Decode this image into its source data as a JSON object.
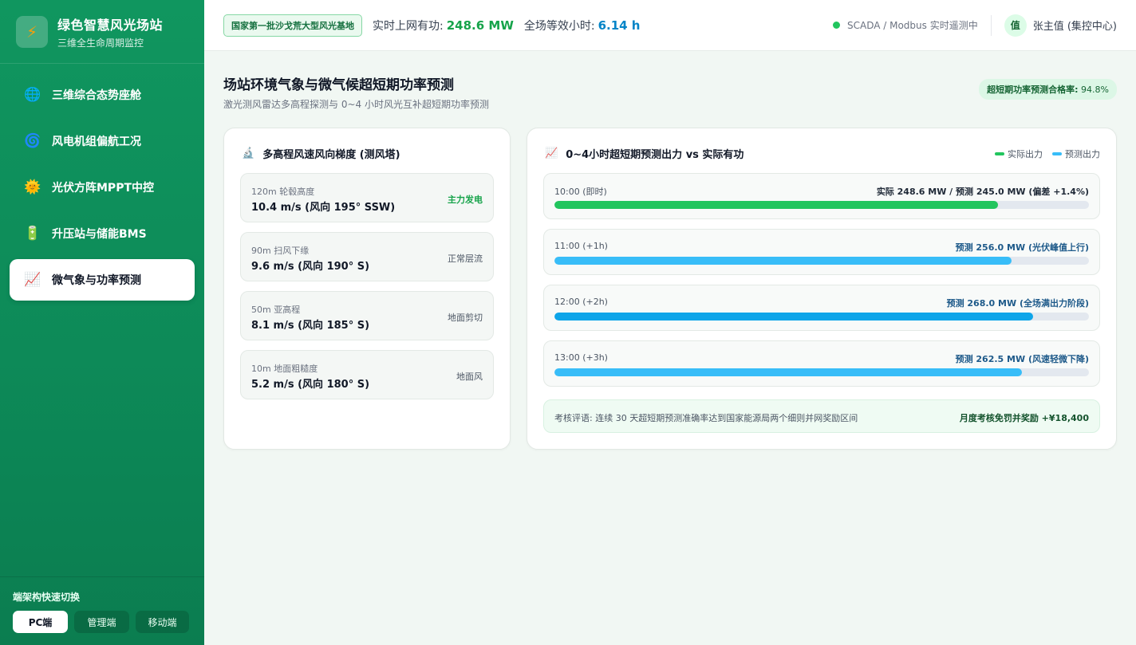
{
  "brand": {
    "title": "绿色智慧风光场站",
    "subtitle": "三维全生命周期监控",
    "icon": "lightning-icon"
  },
  "sidebar": {
    "items": [
      {
        "label": "三维综合态势座舱",
        "icon": "globe-icon",
        "glyph": "🌐",
        "active": false
      },
      {
        "label": "风电机组偏航工况",
        "icon": "cyclone-icon",
        "glyph": "🌀",
        "active": false
      },
      {
        "label": "光伏方阵MPPT中控",
        "icon": "sun-icon",
        "glyph": "🌞",
        "active": false
      },
      {
        "label": "升压站与储能BMS",
        "icon": "battery-icon",
        "glyph": "🔋",
        "active": false
      },
      {
        "label": "微气象与功率预测",
        "icon": "chart-increasing-icon",
        "glyph": "📈",
        "active": true
      }
    ],
    "switcher": {
      "title": "端架构快速切换",
      "buttons": [
        {
          "label": "PC端",
          "active": true
        },
        {
          "label": "管理端",
          "active": false
        },
        {
          "label": "移动端",
          "active": false
        }
      ]
    }
  },
  "header": {
    "badge": "国家第一批沙戈荒大型风光基地",
    "metric1": {
      "label": "实时上网有功:",
      "value": "248.6 MW",
      "color": "#16a34a"
    },
    "metric2": {
      "label": "全场等效小时:",
      "value": "6.14 h",
      "color": "#0284c7"
    },
    "status": "SCADA / Modbus 实时遥测中",
    "avatar": "值",
    "user": "张主值 (集控中心)"
  },
  "main": {
    "title": "场站环境气象与微气候超短期功率预测",
    "subtitle": "激光测风雷达多高程探测与 0~4 小时风光互补超短期功率预测",
    "rate": {
      "label": "超短期功率预测合格率:",
      "value": "94.8%"
    }
  },
  "tower": {
    "title": "多高程风速风向梯度 (测风塔)",
    "icon": "microscope-icon",
    "rows": [
      {
        "height": "120m 轮毂高度",
        "wind": "10.4 m/s (风向 195° SSW)",
        "tag": "主力发电",
        "highlight": true
      },
      {
        "height": "90m 扫风下缘",
        "wind": "9.6 m/s (风向 190° S)",
        "tag": "正常层流",
        "highlight": false
      },
      {
        "height": "50m 亚高程",
        "wind": "8.1 m/s (风向 185° S)",
        "tag": "地面剪切",
        "highlight": false
      },
      {
        "height": "10m 地面粗糙度",
        "wind": "5.2 m/s (风向 180° S)",
        "tag": "地面风",
        "highlight": false
      }
    ]
  },
  "forecast": {
    "title": "0~4小时超短期预测出力 vs 实际有功",
    "icon": "chart-increasing-icon",
    "legend": [
      {
        "label": "实际出力",
        "color": "#22c55e"
      },
      {
        "label": "预测出力",
        "color": "#38bdf8"
      }
    ],
    "rows": [
      {
        "time": "10:00 (即时)",
        "text": "实际 248.6 MW / 预测 245.0 MW (偏差 +1.4%)",
        "fraction": 0.83,
        "color": "#22c55e",
        "textColor": "#1f2937"
      },
      {
        "time": "11:00 (+1h)",
        "text": "预测 256.0 MW (光伏峰值上行)",
        "fraction": 0.855,
        "color": "#38bdf8",
        "textColor": "#1e5a8a"
      },
      {
        "time": "12:00 (+2h)",
        "text": "预测 268.0 MW (全场满出力阶段)",
        "fraction": 0.895,
        "color": "#0ea5e9",
        "textColor": "#1e5a8a"
      },
      {
        "time": "13:00 (+3h)",
        "text": "预测 262.5 MW (风速轻微下降)",
        "fraction": 0.875,
        "color": "#38bdf8",
        "textColor": "#1e5a8a"
      }
    ],
    "evaluation": {
      "text": "考核评语: 连续 30 天超短期预测准确率达到国家能源局两个细则并网奖励区间",
      "value": "月度考核免罚并奖励 +¥18,400"
    }
  }
}
